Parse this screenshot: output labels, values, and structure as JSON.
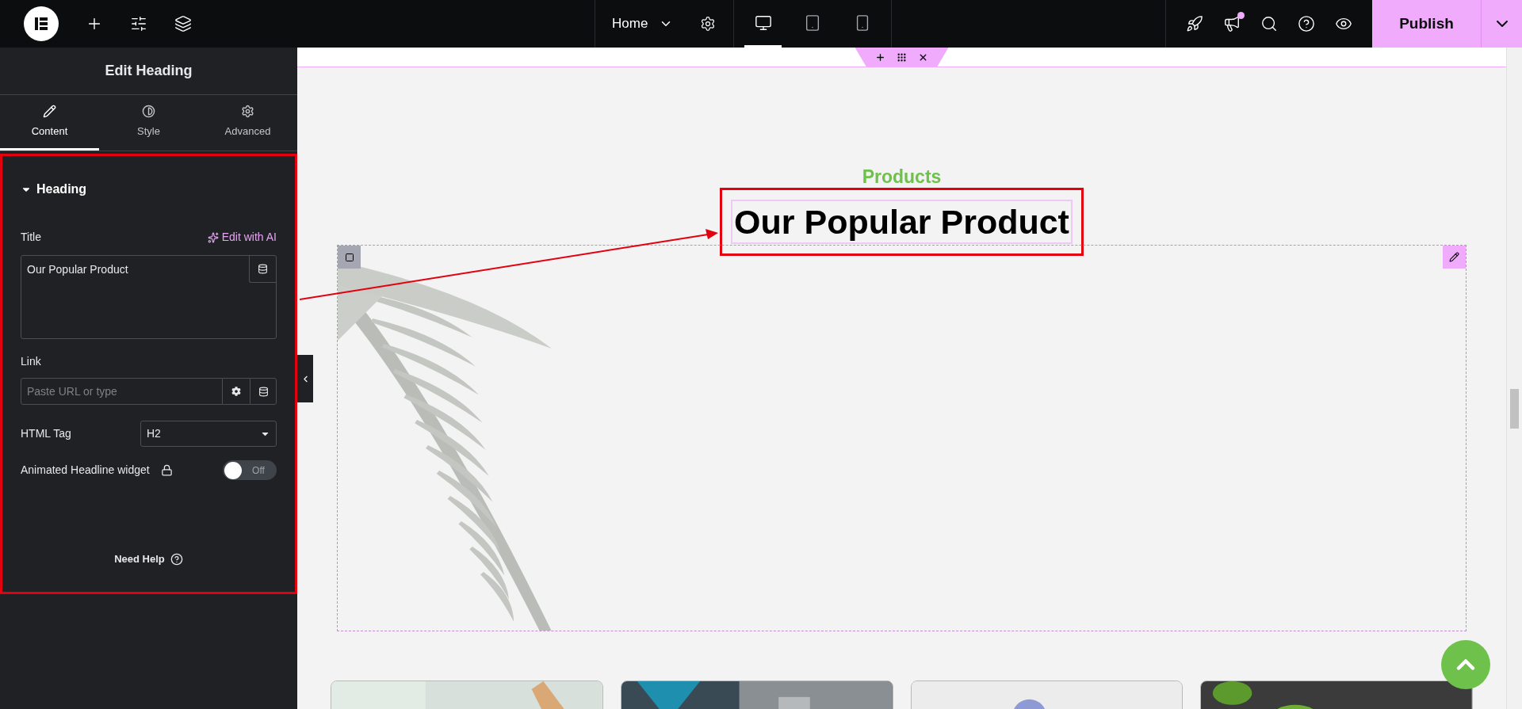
{
  "top_bar": {
    "page_selector": "Home",
    "devices": [
      {
        "kind": "desktop",
        "selected": true
      },
      {
        "kind": "tablet",
        "selected": false
      },
      {
        "kind": "mobile",
        "selected": false
      }
    ],
    "notification": true,
    "publish": "Publish"
  },
  "panel": {
    "title": "Edit Heading",
    "tabs": [
      {
        "label": "Content",
        "kind": "pencil",
        "selected": true
      },
      {
        "label": "Style",
        "kind": "contrast",
        "selected": false
      },
      {
        "label": "Advanced",
        "kind": "gear",
        "selected": false
      }
    ],
    "section": {
      "label": "Heading",
      "expanded": true
    },
    "title_label": "Title",
    "ai_link": "Edit with AI",
    "title_value": "Our Popular Product",
    "link_label": "Link",
    "link_placeholder": "Paste URL or type",
    "tag_label": "HTML Tag",
    "tag_value": "H2",
    "animated_label": "Animated Headline widget",
    "animated_toggle": {
      "on": false,
      "text": "Off"
    },
    "help": "Need Help"
  },
  "canvas": {
    "subtitle": "Products",
    "heading": "Our Popular Product"
  }
}
